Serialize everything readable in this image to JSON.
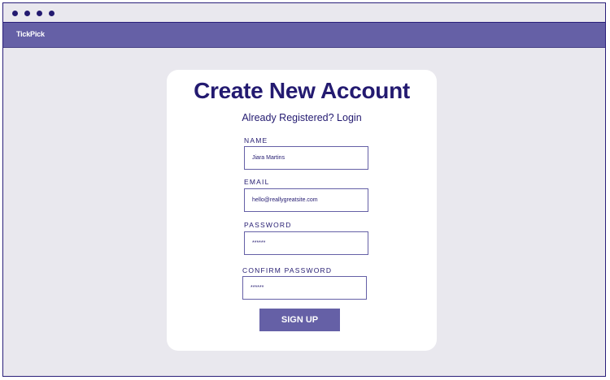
{
  "app": {
    "brand": "TickPick"
  },
  "form": {
    "title": "Create New Account",
    "login_link": "Already Registered? Login",
    "fields": [
      {
        "label": "NAME",
        "value": "Jiara Martins"
      },
      {
        "label": "EMAIL",
        "value": "hello@reallygreatsite.com"
      },
      {
        "label": "PASSWORD",
        "value": "******"
      },
      {
        "label": "CONFIRM PASSWORD",
        "value": "******"
      }
    ],
    "submit_label": "SIGN UP"
  }
}
